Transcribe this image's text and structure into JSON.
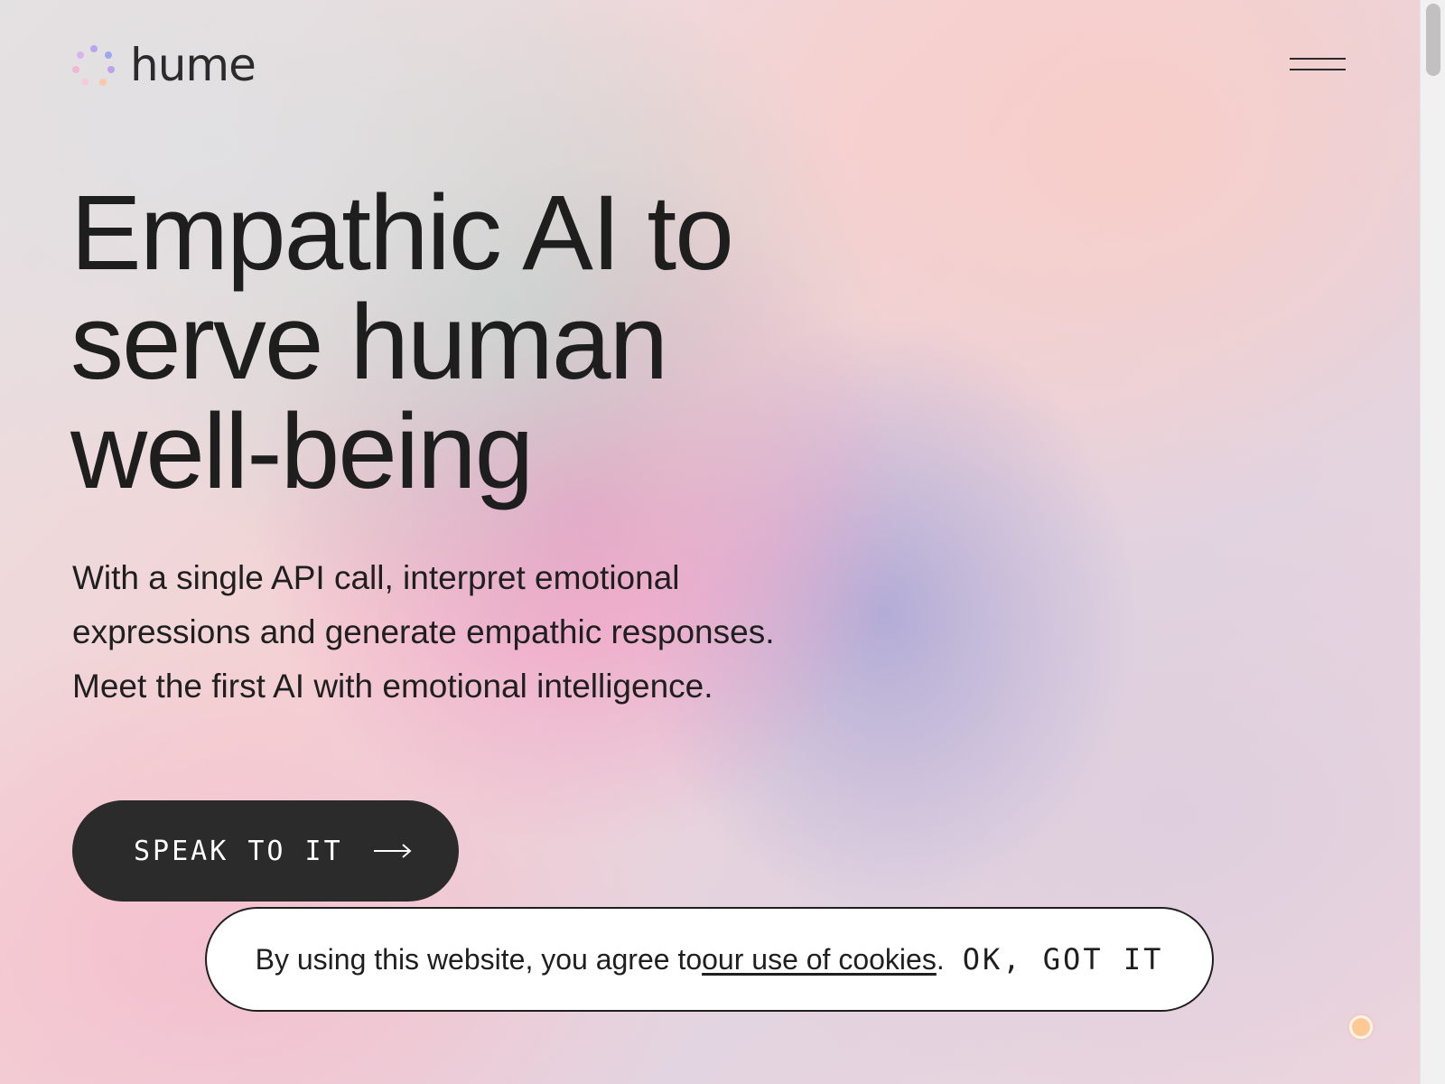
{
  "header": {
    "logo_text": "hume",
    "logo_icon": "hume-dots-logo",
    "menu_icon": "hamburger-menu-icon"
  },
  "hero": {
    "title_lines": [
      "Empathic AI to",
      "serve human",
      "well-being"
    ],
    "subtitle_lines": [
      "With a single API call, interpret emotional",
      "expressions and generate empathic responses.",
      "Meet the first AI with emotional intelligence."
    ],
    "cta_label": "SPEAK TO IT",
    "cta_icon": "arrow-right-icon"
  },
  "cookie_banner": {
    "text_before": "By using this website, you agree to ",
    "link_text": "our use of cookies",
    "text_after": ".",
    "accept_label": "OK, GOT IT"
  },
  "colors": {
    "text": "#1f1f1f",
    "cta_bg": "#2b2b2b",
    "cta_text": "#ffffff",
    "orb": "#ffc996",
    "logo_dots": [
      "#b9a6f0",
      "#9aa6f2",
      "#f0b4d6",
      "#f6c8b0",
      "#c4a6ee"
    ]
  }
}
